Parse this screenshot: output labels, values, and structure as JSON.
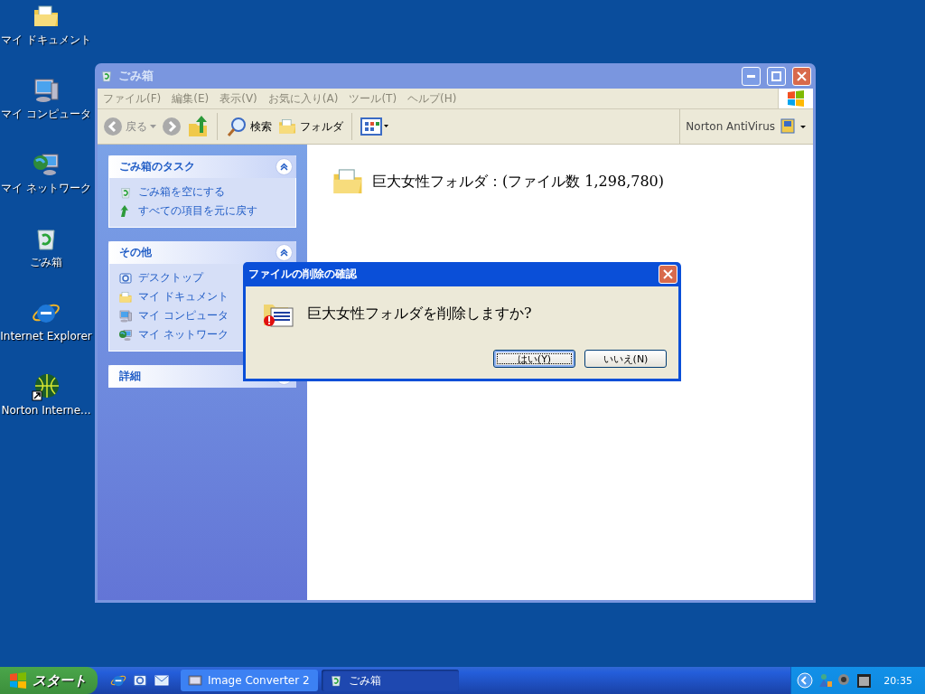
{
  "desktop_icons": [
    {
      "label": "マイ ドキュメント",
      "kind": "documents"
    },
    {
      "label": "マイ コンピュータ",
      "kind": "computer"
    },
    {
      "label": "マイ ネットワーク",
      "kind": "network"
    },
    {
      "label": "ごみ箱",
      "kind": "recycle"
    },
    {
      "label": "Internet Explorer",
      "kind": "ie"
    },
    {
      "label": "Norton Interne...",
      "kind": "globe"
    }
  ],
  "window": {
    "title": "ごみ箱",
    "active": false,
    "menu": [
      "ファイル(F)",
      "編集(E)",
      "表示(V)",
      "お気に入り(A)",
      "ツール(T)",
      "ヘルプ(H)"
    ],
    "toolbar": {
      "back": "戻る",
      "search": "検索",
      "folders": "フォルダ",
      "norton": "Norton AntiVirus"
    },
    "sidebar": [
      {
        "title": "ごみ箱のタスク",
        "expanded": true,
        "items": [
          {
            "label": "ごみ箱を空にする",
            "kind": "recycle"
          },
          {
            "label": "すべての項目を元に戻す",
            "kind": "restore"
          }
        ]
      },
      {
        "title": "その他",
        "expanded": true,
        "items": [
          {
            "label": "デスクトップ",
            "kind": "desktop"
          },
          {
            "label": "マイ ドキュメント",
            "kind": "documents"
          },
          {
            "label": "マイ コンピュータ",
            "kind": "computer"
          },
          {
            "label": "マイ ネットワーク",
            "kind": "network"
          }
        ]
      },
      {
        "title": "詳細",
        "expanded": false
      }
    ],
    "content": {
      "folder": "巨大女性フォルダ：(ファイル数 1,298,780)"
    }
  },
  "dialog": {
    "title": "ファイルの削除の確認",
    "message": "巨大女性フォルダを削除しますか?",
    "buttons": [
      {
        "label": "はい(Y)",
        "selected": true
      },
      {
        "label": "いいえ(N)",
        "selected": false
      }
    ]
  },
  "taskbar": {
    "start": "スタート",
    "tasks": [
      {
        "label": "Image Converter 2",
        "selected": false,
        "kind": "converter"
      },
      {
        "label": "ごみ箱",
        "selected": true,
        "kind": "recycle"
      }
    ],
    "clock": "20:35"
  }
}
